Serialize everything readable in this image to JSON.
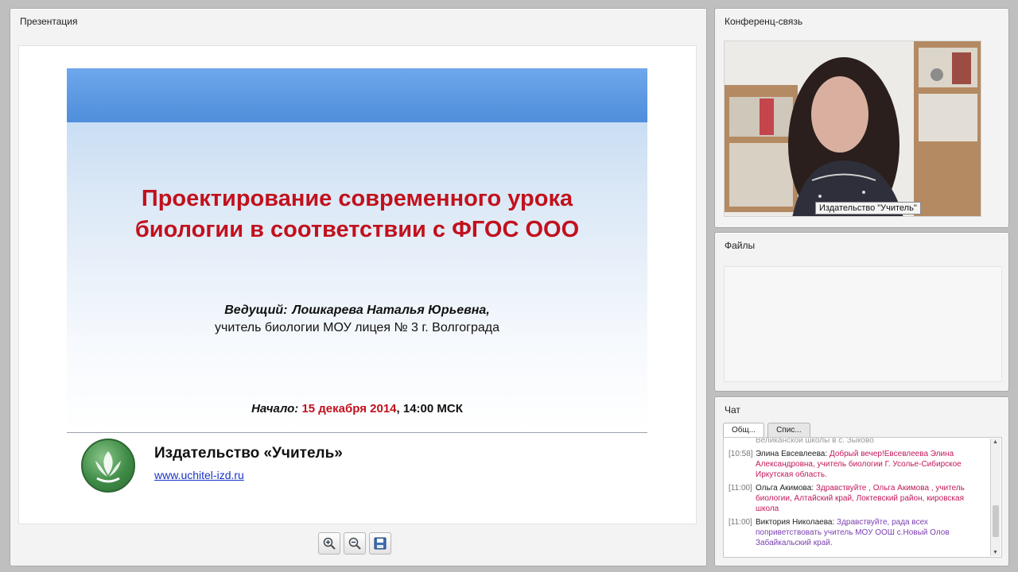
{
  "presentation_panel": {
    "title": "Презентация",
    "slide": {
      "title_line1": "Проектирование современного урока",
      "title_line2": "биологии в соответствии с ФГОС ООО",
      "presenter_label": "Ведущий:",
      "presenter_name": "Лошкарева Наталья Юрьевна,",
      "presenter_role": "учитель биологии МОУ лицея № 3 г. Волгограда",
      "start_label": "Начало:",
      "start_date": "15 декабря 2014",
      "start_time": ", 14:00 МСК",
      "publisher": "Издательство «Учитель»",
      "publisher_url": "www.uchitel-izd.ru"
    },
    "toolbar": {
      "zoom_in_icon": "zoom-in-icon",
      "zoom_out_icon": "zoom-out-icon",
      "save_icon": "save-icon"
    }
  },
  "conference_panel": {
    "title": "Конференц-связь",
    "video_caption": "Издательство \"Учитель\""
  },
  "files_panel": {
    "title": "Файлы"
  },
  "chat_panel": {
    "title": "Чат",
    "tabs": [
      "Общ...",
      "Спис..."
    ],
    "clipped_line": "Великанской школы в с. Зыково",
    "messages": [
      {
        "time": "[10:58]",
        "author": "Элина Евсевлеева:",
        "text": "Добрый вечер!Евсевлеева Элина Александровна, учитель биологии Г. Усолье-Сибирское Иркутская область."
      },
      {
        "time": "[11:00]",
        "author": "Ольга Акимова:",
        "text": "Здравствуйте , Ольга Акимова , учитель биологии, Алтайский край, Локтевский район, кировская школа"
      },
      {
        "time": "[11:00]",
        "author": "Виктория Николаева:",
        "text": "Здравствуйте, рада всех поприветствовать учитель МОУ ООШ с.Новый Олов Забайкальский край."
      }
    ]
  },
  "colors": {
    "title_red": "#c1111d",
    "band_blue": "#4f8edb",
    "chat_red": "#c2185b",
    "chat_purple": "#7b3fb0",
    "link_blue": "#1a33c7"
  }
}
